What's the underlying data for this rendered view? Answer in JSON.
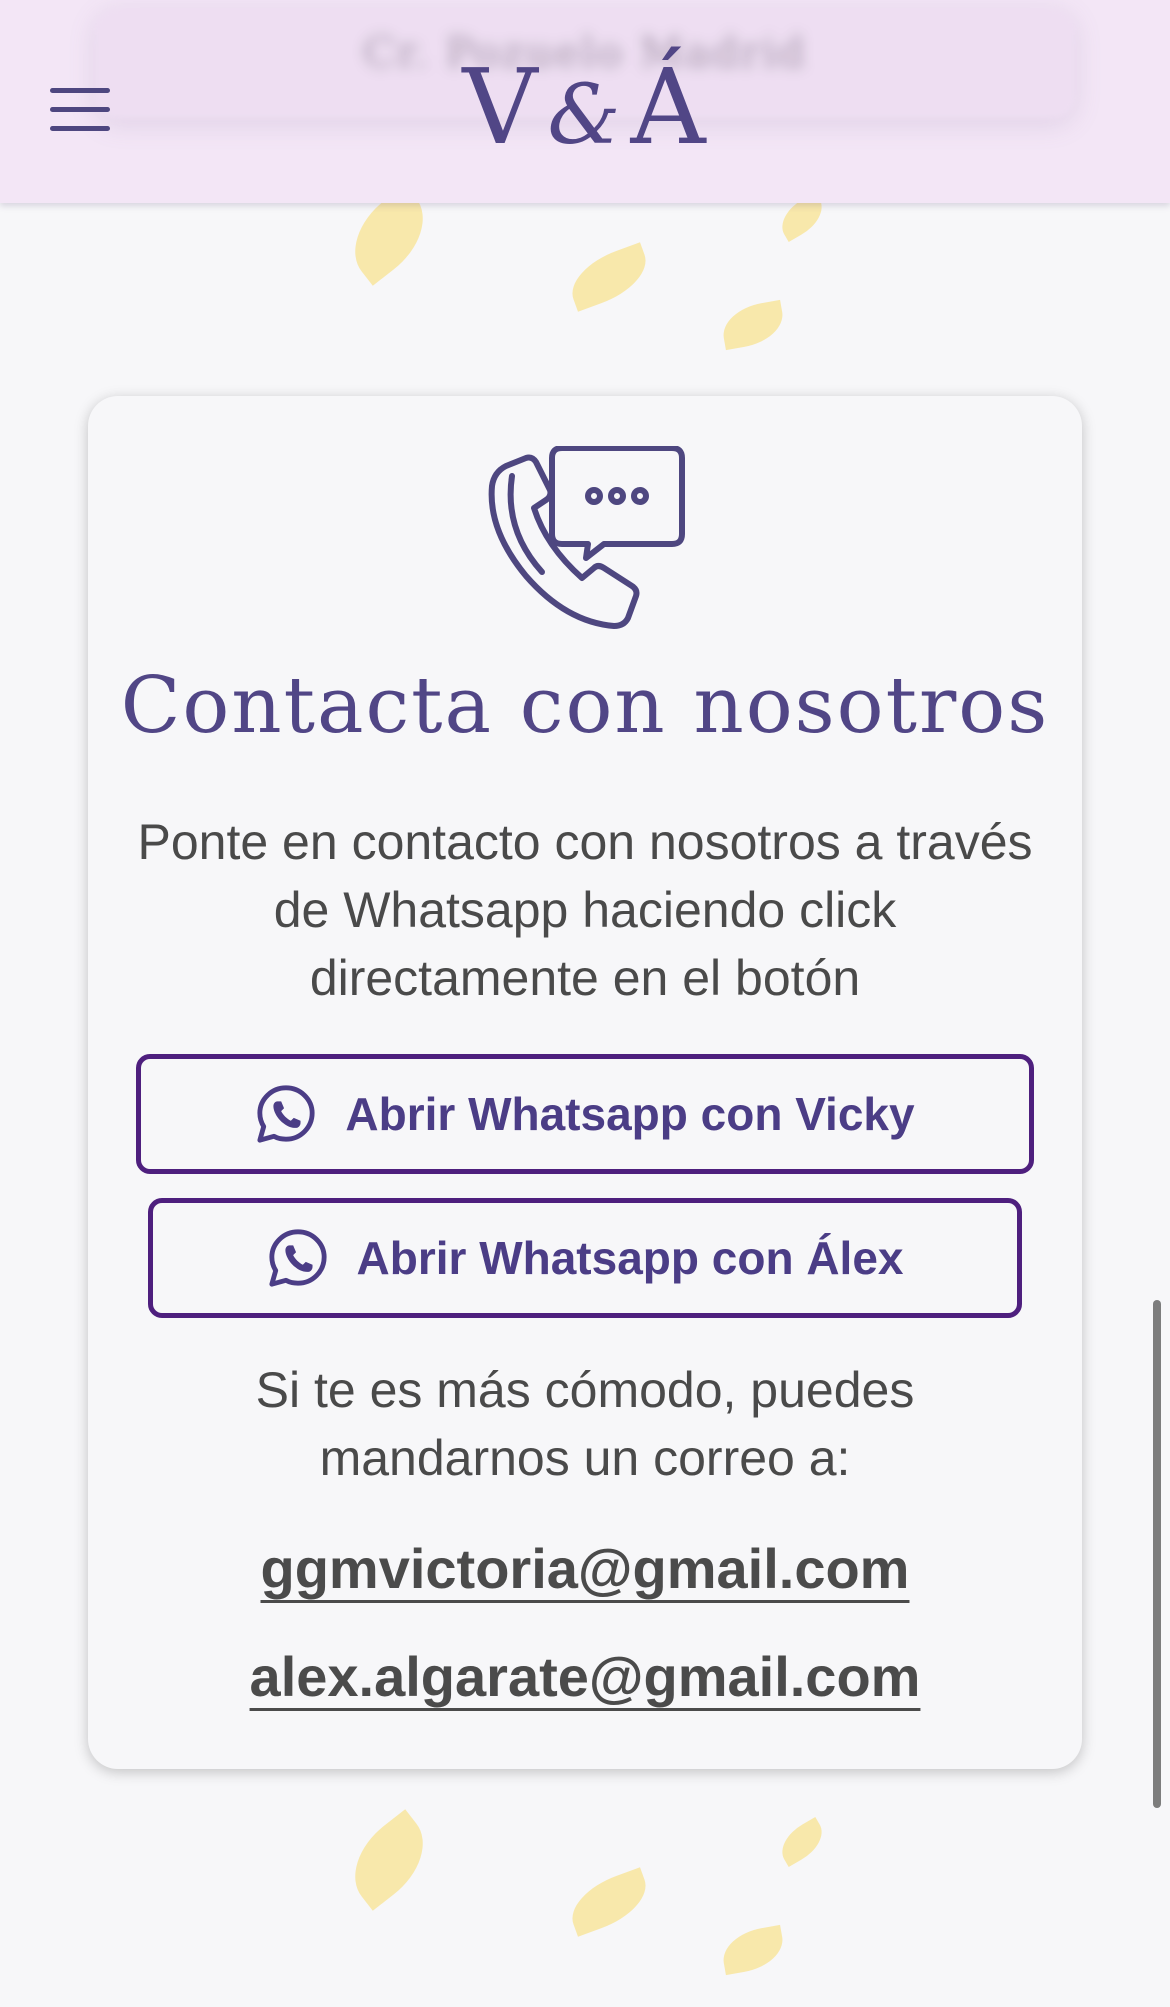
{
  "header": {
    "logo": {
      "left": "V",
      "amp": "&",
      "right": "Á"
    },
    "menu_icon": "hamburger-menu-icon",
    "background_text": "Cr. Pozuelo Madrid"
  },
  "contact_card": {
    "icon": "phone-chat-icon",
    "title": "Contacta con nosotros",
    "description": "Ponte en contacto con nosotros a través de Whatsapp haciendo click directamente en el botón",
    "buttons": [
      {
        "label": "Abrir Whatsapp con Vicky",
        "icon": "whatsapp-icon"
      },
      {
        "label": "Abrir Whatsapp con Álex",
        "icon": "whatsapp-icon"
      }
    ],
    "alt_text": "Si te es más cómodo, puedes mandarnos un correo a:",
    "emails": [
      "ggmvictoria@gmail.com",
      "alex.algarate@gmail.com"
    ]
  },
  "colors": {
    "header_bg": "#f3e6f6",
    "accent_purple": "#514686",
    "button_border": "#4e1f7e",
    "page_bg": "#f7f7f9",
    "petal": "#f8e7a6"
  }
}
